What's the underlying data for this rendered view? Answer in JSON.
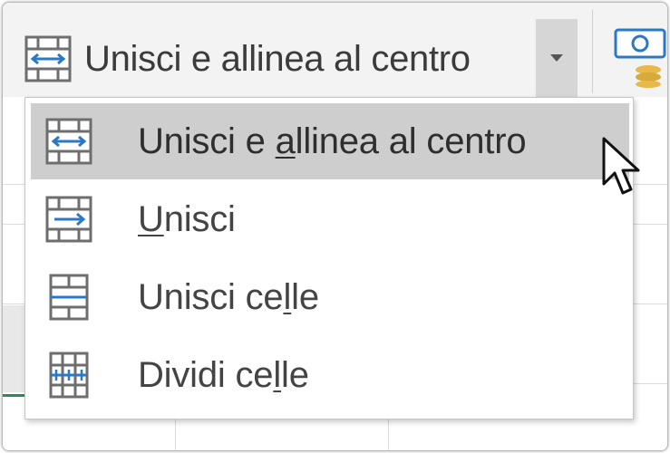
{
  "ribbon": {
    "merge_center_label": "Unisci e allinea al centro"
  },
  "menu": {
    "items": [
      {
        "pre": "Unisci e ",
        "key": "a",
        "post": "llinea al centro",
        "icon": "merge-center-icon",
        "active": true
      },
      {
        "pre": "",
        "key": "U",
        "post": "nisci",
        "icon": "merge-across-icon",
        "active": false
      },
      {
        "pre": "Unisci ce",
        "key": "l",
        "post": "le",
        "icon": "merge-cells-icon",
        "active": false
      },
      {
        "pre": "Dividi ce",
        "key": "l",
        "post": "le",
        "icon": "unmerge-cells-icon",
        "active": false
      }
    ]
  },
  "colors": {
    "ribbon_bg": "#f3f3f3",
    "hover_bg": "#cecece",
    "icon_blue": "#2b78c4",
    "icon_frame": "#6e6e6e"
  }
}
